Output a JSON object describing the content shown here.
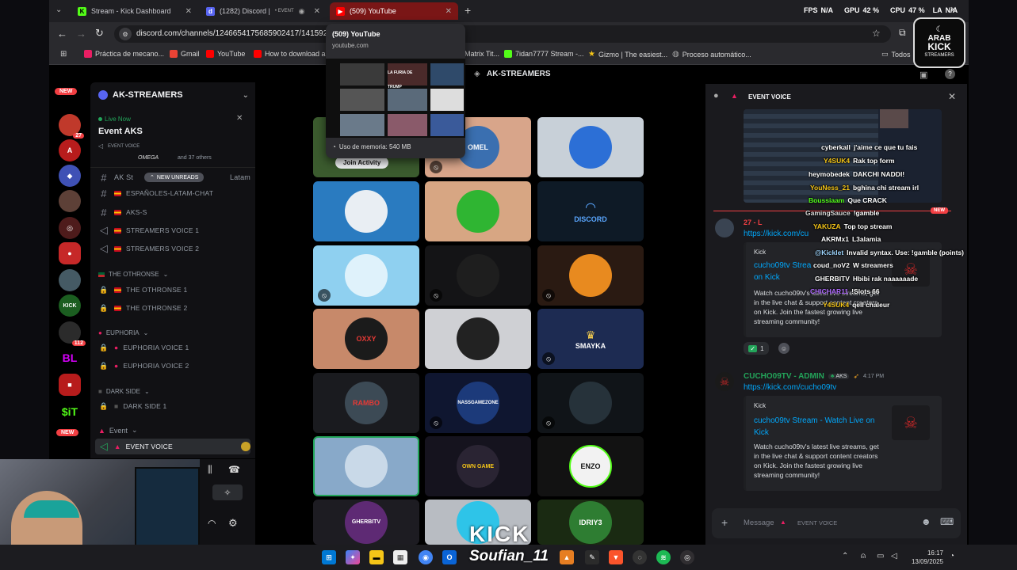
{
  "browser": {
    "tabs": [
      {
        "label": "Stream - Kick Dashboard",
        "icon": "kick-icon",
        "color": "#53fc18"
      },
      {
        "label": "(1282) Discord | ",
        "icon": "discord-icon",
        "color": "#5865f2",
        "extra": "• EVENT"
      },
      {
        "label": "(509) YouTube",
        "icon": "youtube-icon",
        "color": "#ff0000"
      }
    ],
    "new_tab": "+",
    "perf": {
      "fps_label": "FPS",
      "fps_value": "N/A",
      "gpu_label": "GPU",
      "gpu_value": "42 %",
      "cpu_label": "CPU",
      "cpu_value": "47 %",
      "lat_label": "LA",
      "lat_value": "N/A"
    },
    "url": "discord.com/channels/1246654175685902417/14159277",
    "bookmarks": [
      {
        "label": "Práctica de mecano...",
        "color": "#e91e63"
      },
      {
        "label": "Gmail",
        "color": "#ea4335"
      },
      {
        "label": "YouTube",
        "color": "#ff0000"
      },
      {
        "label": "How to download a...",
        "color": "#ff0000"
      },
      {
        "label": "Matrix Tit...",
        "color": "#666666"
      },
      {
        "label": "7idan7777 Stream -...",
        "color": "#53fc18"
      },
      {
        "label": "Gizmo | The easiest...",
        "color": "#f5c518"
      },
      {
        "label": "Proceso automático...",
        "color": "#888888"
      }
    ],
    "bookmarks_all": "Todos"
  },
  "tab_preview": {
    "title": "(509) YouTube",
    "domain": "youtube.com",
    "memory": "Uso de memoria: 540 MB",
    "thumb_label_1": "LA FURIA DE TRUMP"
  },
  "guilds": {
    "new_badge": "NEW",
    "new_badge_2": "NEW",
    "badge_27": "27",
    "badge_112": "112",
    "bl_label": "BL",
    "sit_label": "$iT"
  },
  "server": {
    "name": "AK-STREAMERS",
    "live_label": "Live Now",
    "event_title": "Event AKS",
    "event_sub": "EVENT VOICE",
    "event_attendees": "and 37 others",
    "event_user": "OMEGA",
    "new_unreads": "NEW UNREADS",
    "channels": [
      {
        "name": "AK St",
        "suffix": "Latam",
        "icon": "#"
      },
      {
        "name": "ESPAÑOLES-LATAM-CHAT",
        "icon": "#"
      },
      {
        "name": "AKS-S",
        "icon": "#"
      },
      {
        "name": "STREAMERS VOICE 1",
        "icon": "voice"
      },
      {
        "name": "STREAMERS VOICE 2",
        "icon": "voice"
      }
    ],
    "cat_othronse": "THE OTHRONSE",
    "othronse_channels": [
      "THE OTHRONSE 1",
      "THE OTHRONSE 2"
    ],
    "cat_euphoria": "EUPHORIA",
    "euphoria_channels": [
      "EUPHORIA VOICE 1",
      "EUPHORIA VOICE 2"
    ],
    "cat_dark": "DARK SIDE",
    "dark_channels": [
      "DARK SIDE 1"
    ],
    "cat_event": "Event",
    "event_channel": "EVENT VOICE"
  },
  "main": {
    "header": "AK-STREAMERS",
    "join_activity": "Join Activity",
    "tile_labels": {
      "discord": "DISCORD",
      "smayka": "SMAYKA",
      "oxy": "OXXY",
      "rambo": "RAMBO",
      "nassgamezone": "NASSGAMEZONE",
      "lowngame": "OWN GAME",
      "enzo": "ENZO",
      "gherbitv": "GHERBITV",
      "idriy3": "IDRIY3",
      "omelo": "OMEL"
    },
    "watermark_1": "KICK",
    "watermark_2": "Soufian_11"
  },
  "chat": {
    "title": "EVENT VOICE",
    "overlay": [
      {
        "user": "cyberkall",
        "text": "j'aime ce que tu fais",
        "color": "#ffffff"
      },
      {
        "user": "Y4SUK4",
        "text": "Rak top form",
        "color": "#f5c518"
      },
      {
        "user": "heymobedek",
        "text": "DAKCHI NADDI!",
        "color": "#ffffff"
      },
      {
        "user": "YouNess_21",
        "text": "bghina chi stream irl",
        "color": "#f5c518"
      },
      {
        "user": "Boussiaam",
        "text": "Que CRACK",
        "color": "#53fc18"
      },
      {
        "user": "GamingSauce",
        "text": "!gamble",
        "color": "#dddddd"
      },
      {
        "user": "YAKUZA",
        "text": "Top top stream",
        "color": "#f5c518"
      },
      {
        "user": "AKRMx1",
        "text": "L3alamia",
        "color": "#ffffff"
      },
      {
        "user": "@Kicklet",
        "text": "Invalid syntax. Use: !gamble (points)",
        "color": "#9fd6ff"
      },
      {
        "user": "coud_noV2",
        "text": "W streamers",
        "color": "#ffffff"
      },
      {
        "user": "GHERBITV",
        "text": "Hbibi rak naaaaaade",
        "color": "#ffffff"
      },
      {
        "user": "CHICHAR11",
        "text": "!Slots 66",
        "color": "#b06bff"
      },
      {
        "user": "Y4SUK4",
        "text": "qell chaleur",
        "color": "#f5c518"
      }
    ],
    "msg1_name": "27 - L",
    "msg1_link": "https://kick.com/cu",
    "new_tag": "NEW",
    "embed1": {
      "provider": "Kick",
      "title_part": "cucho09tv Strea",
      "title_end": "on Kick",
      "desc": "Watch cucho09tv's latest live streams, get in the live chat & support content creators on Kick. Join the fastest growing live streaming community!"
    },
    "reaction_count": "1",
    "msg2": {
      "name": "CUCHO09TV - ADMIN",
      "tag": "AKS",
      "time": "4:17 PM",
      "link": "https://kick.com/cucho09tv"
    },
    "embed2": {
      "provider": "Kick",
      "title": "cucho09tv Stream - Watch Live on Kick",
      "desc": "Watch cucho09tv's latest live streams, get in the live chat & support content creators on Kick. Join the fastest growing live streaming community!"
    },
    "input_placeholder": "Message",
    "input_channel": "EVENT VOICE"
  },
  "webcam": {
    "viewer_count": "196"
  },
  "taskbar": {
    "time": "16:17",
    "date": "13/09/2025"
  },
  "overlay_logo": {
    "line1": "ARAB",
    "line2": "KICK",
    "line3": "STREAMERS"
  }
}
